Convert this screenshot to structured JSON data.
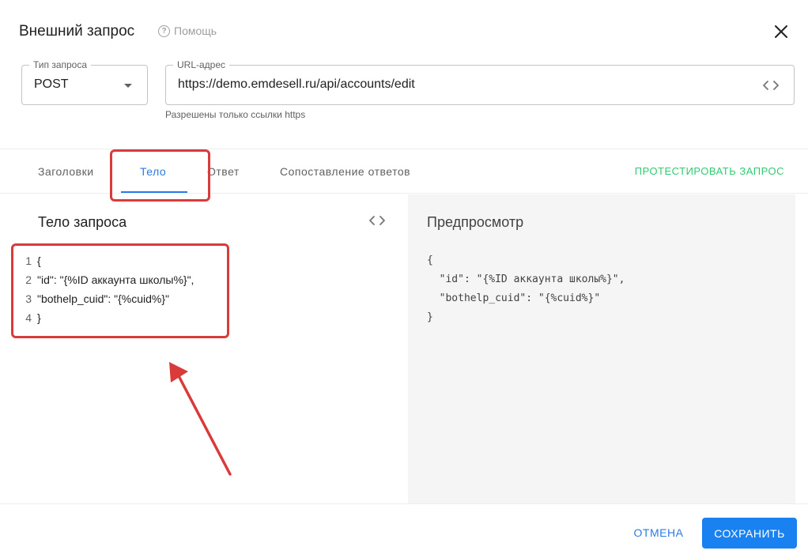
{
  "dialog": {
    "title": "Внешний запрос",
    "help_label": "Помощь"
  },
  "request_type": {
    "label": "Тип запроса",
    "value": "POST"
  },
  "url": {
    "label": "URL-адрес",
    "value": "https://demo.emdesell.ru/api/accounts/edit",
    "hint": "Разрешены только ссылки https"
  },
  "tabs": [
    {
      "label": "Заголовки",
      "active": false
    },
    {
      "label": "Тело",
      "active": true
    },
    {
      "label": "Ответ",
      "active": false
    },
    {
      "label": "Сопоставление ответов",
      "active": false
    }
  ],
  "test_button": "ПРОТЕСТИРОВАТЬ ЗАПРОС",
  "body_panel": {
    "title": "Тело запроса",
    "lines": [
      {
        "no": "1",
        "text": "{"
      },
      {
        "no": "2",
        "text": "\"id\": \"{%ID аккаунта школы%}\","
      },
      {
        "no": "3",
        "text": "\"bothelp_cuid\": \"{%cuid%}\""
      },
      {
        "no": "4",
        "text": "}"
      }
    ]
  },
  "preview_panel": {
    "title": "Предпросмотр",
    "text": "{\n  \"id\": \"{%ID аккаунта школы%}\",\n  \"bothelp_cuid\": \"{%cuid%}\"\n}"
  },
  "footer": {
    "cancel": "ОТМЕНА",
    "save": "СОХРАНИТЬ"
  },
  "colors": {
    "accent": "#2a7be4",
    "save_bg": "#1a82f0",
    "test_green": "#2ecc71",
    "annotation_red": "#d93a3a"
  }
}
